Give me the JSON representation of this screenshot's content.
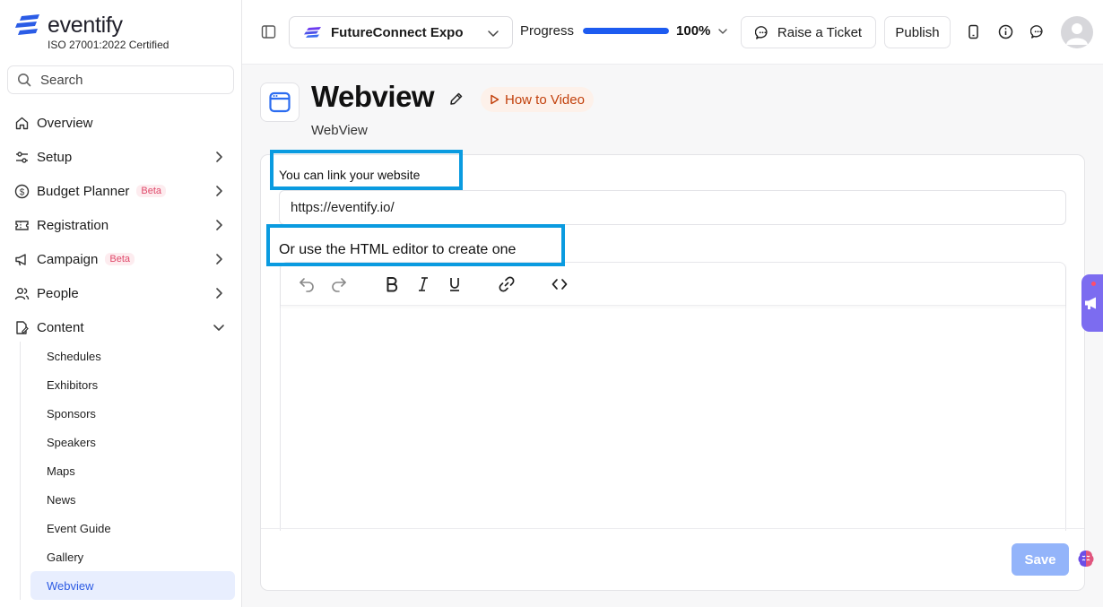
{
  "brand": {
    "name": "eventify",
    "certification": "ISO 27001:2022 Certified"
  },
  "search": {
    "placeholder": "Search"
  },
  "nav": [
    {
      "label": "Overview",
      "icon": "home-icon"
    },
    {
      "label": "Setup",
      "icon": "sliders-icon"
    },
    {
      "label": "Budget Planner",
      "icon": "dollar-circle-icon",
      "badge": "Beta"
    },
    {
      "label": "Registration",
      "icon": "ticket-icon"
    },
    {
      "label": "Campaign",
      "icon": "megaphone-icon",
      "badge": "Beta"
    },
    {
      "label": "People",
      "icon": "users-icon"
    },
    {
      "label": "Content",
      "icon": "file-edit-icon"
    }
  ],
  "content_subnav": [
    "Schedules",
    "Exhibitors",
    "Sponsors",
    "Speakers",
    "Maps",
    "News",
    "Event Guide",
    "Gallery",
    "Webview"
  ],
  "topbar": {
    "event_name": "FutureConnect Expo",
    "progress_label": "Progress",
    "progress_value": "100%",
    "progress_fraction": 1.0,
    "raise_ticket": "Raise a Ticket",
    "publish": "Publish"
  },
  "page": {
    "title": "Webview",
    "how_to": "How to Video",
    "subtitle": "WebView",
    "link_label": "You can link your website",
    "url_value": "https://eventify.io/",
    "editor_label": "Or use the HTML editor to create one",
    "save": "Save"
  },
  "colors": {
    "accent": "#1d5bf0",
    "highlight": "#0a9be0",
    "save_disabled": "#93b4fa",
    "beta": "#e04a6b"
  }
}
